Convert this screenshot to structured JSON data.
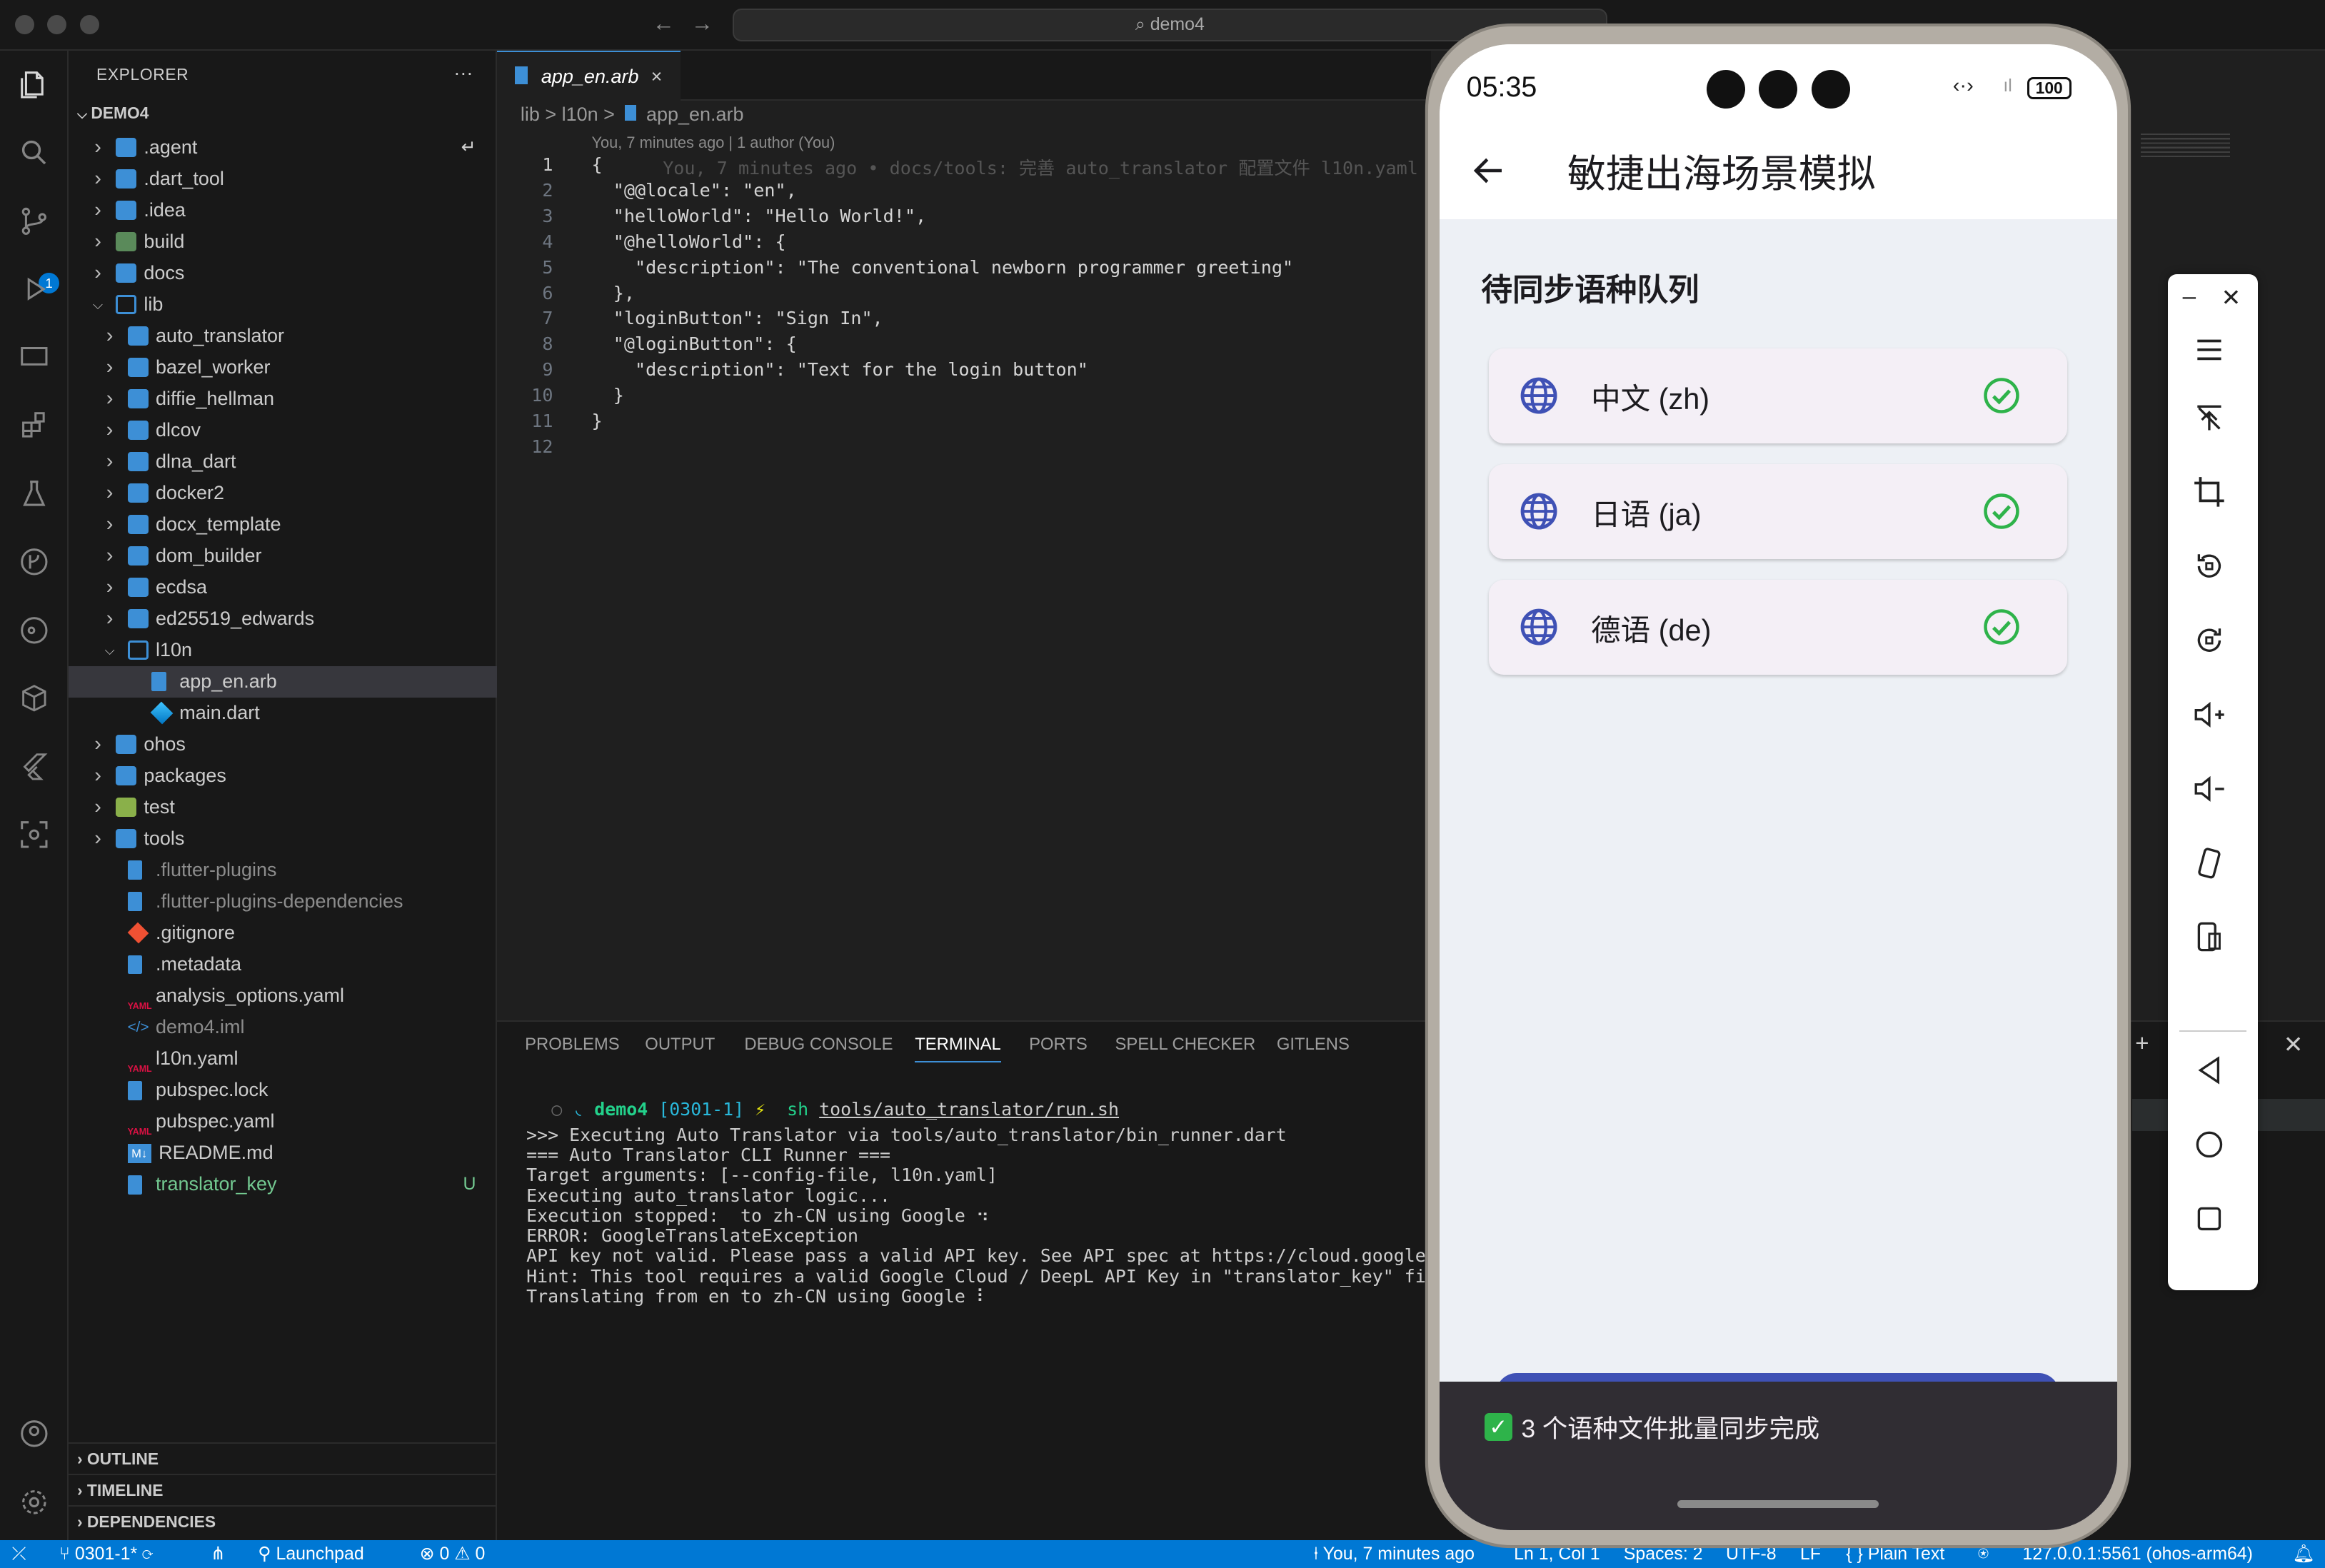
{
  "titlebar": {
    "search": "demo4"
  },
  "explorer": {
    "header": "EXPLORER",
    "more": "···",
    "root": "DEMO4",
    "items": [
      {
        "label": ".agent",
        "git": "↵"
      },
      {
        "label": ".dart_tool"
      },
      {
        "label": ".idea"
      },
      {
        "label": "build"
      },
      {
        "label": "docs"
      },
      {
        "label": "lib"
      },
      {
        "label": "auto_translator"
      },
      {
        "label": "bazel_worker"
      },
      {
        "label": "diffie_hellman"
      },
      {
        "label": "dlcov"
      },
      {
        "label": "dlna_dart"
      },
      {
        "label": "docker2"
      },
      {
        "label": "docx_template"
      },
      {
        "label": "dom_builder"
      },
      {
        "label": "ecdsa"
      },
      {
        "label": "ed25519_edwards"
      },
      {
        "label": "l10n"
      },
      {
        "label": "app_en.arb"
      },
      {
        "label": "main.dart"
      },
      {
        "label": "ohos"
      },
      {
        "label": "packages"
      },
      {
        "label": "test"
      },
      {
        "label": "tools"
      },
      {
        "label": ".flutter-plugins"
      },
      {
        "label": ".flutter-plugins-dependencies"
      },
      {
        "label": ".gitignore"
      },
      {
        "label": ".metadata"
      },
      {
        "label": "analysis_options.yaml"
      },
      {
        "label": "demo4.iml"
      },
      {
        "label": "l10n.yaml"
      },
      {
        "label": "pubspec.lock"
      },
      {
        "label": "pubspec.yaml"
      },
      {
        "label": "README.md"
      },
      {
        "label": "translator_key",
        "git": "U"
      }
    ],
    "sections": [
      "OUTLINE",
      "TIMELINE",
      "DEPENDENCIES"
    ]
  },
  "editor": {
    "tab": "app_en.arb",
    "breadcrumb": [
      "lib",
      ">",
      "l10n",
      ">",
      "app_en.arb"
    ],
    "blame": "You, 7 minutes ago | 1 author (You)",
    "ghost": "You, 7 minutes ago • docs/tools: 完善 auto_translator 配置文件 l10n.yaml 并…",
    "lines": [
      "{",
      "  \"@@locale\": \"en\",",
      "  \"helloWorld\": \"Hello World!\",",
      "  \"@helloWorld\": {",
      "    \"description\": \"The conventional newborn programmer greeting\"",
      "  },",
      "  \"loginButton\": \"Sign In\",",
      "  \"@loginButton\": {",
      "    \"description\": \"Text for the login button\"",
      "  }",
      "}",
      ""
    ],
    "line_numbers": [
      "1",
      "2",
      "3",
      "4",
      "5",
      "6",
      "7",
      "8",
      "9",
      "10",
      "11",
      "12"
    ]
  },
  "panel": {
    "tabs": [
      "PROBLEMS",
      "OUTPUT",
      "DEBUG CONSOLE",
      "TERMINAL",
      "PORTS",
      "SPELL CHECKER",
      "GITLENS"
    ],
    "active_tab": "TERMINAL",
    "prompt": {
      "dir": "demo4",
      "branch": "[0301-1]",
      "bolt": "⚡",
      "cmd": "sh",
      "arg": "tools/auto_translator/run.sh"
    },
    "output": [
      ">>> Executing Auto Translator via tools/auto_translator/bin_runner.dart",
      "=== Auto Translator CLI Runner ===",
      "Target arguments: [--config-file, l10n.yaml]",
      "Executing auto_translator logic...",
      "Execution stopped:  to zh-CN using Google ⠲",
      "ERROR: GoogleTranslateException",
      "API key not valid. Please pass a valid API key. See API spec at https://cloud.google.com/t",
      "Hint: This tool requires a valid Google Cloud / DeepL API Key in \"translator_key\" file.",
      "Translating from en to zh-CN using Google ⠇"
    ]
  },
  "statusbar": {
    "branch": "0301-1*",
    "launchpad": "Launchpad",
    "errors": "0",
    "warnings": "0",
    "blame": "You, 7 minutes ago",
    "position": "Ln 1, Col 1",
    "spaces": "Spaces: 2",
    "encoding": "UTF-8",
    "eol": "LF",
    "language": "Plain Text",
    "device": "127.0.0.1:5561 (ohos-arm64)"
  },
  "phone": {
    "time": "05:35",
    "battery": "100",
    "title": "敏捷出海场景模拟",
    "section": "待同步语种队列",
    "languages": [
      {
        "label": "中文 (zh)"
      },
      {
        "label": "日语 (ja)"
      },
      {
        "label": "德语 (de)"
      }
    ],
    "snackbar": "3 个语种文件批量同步完成",
    "colors": {
      "globe": "#3f51b5",
      "check": "#2eb34a",
      "snack_bg": "#302d33"
    }
  }
}
